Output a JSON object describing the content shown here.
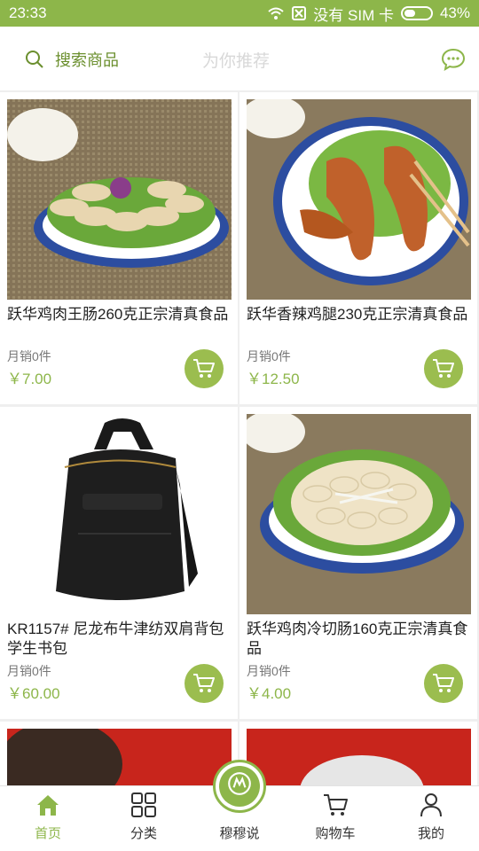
{
  "status_bar": {
    "time": "23:33",
    "carrier_text": "没有 SIM 卡",
    "battery": "43%",
    "battery_level": 0.43
  },
  "header": {
    "search_label": "搜索商品",
    "recommend_label": "为你推荐"
  },
  "products": [
    {
      "title": "跃华鸡肉王肠260克正宗清真食品",
      "sales": "月销0件",
      "price": "￥7.00"
    },
    {
      "title": "跃华香辣鸡腿230克正宗清真食品",
      "sales": "月销0件",
      "price": "￥12.50"
    },
    {
      "title": "KR1157# 尼龙布牛津纺双肩背包 学生书包",
      "sales": "月销0件",
      "price": "￥60.00"
    },
    {
      "title": "跃华鸡肉冷切肠160克正宗清真食品",
      "sales": "月销0件",
      "price": "￥4.00"
    }
  ],
  "nav": {
    "home": "首页",
    "category": "分类",
    "center": "穆穆说",
    "cart": "购物车",
    "me": "我的"
  },
  "colors": {
    "accent": "#8db64a",
    "cart_button": "#9bbd4f"
  }
}
